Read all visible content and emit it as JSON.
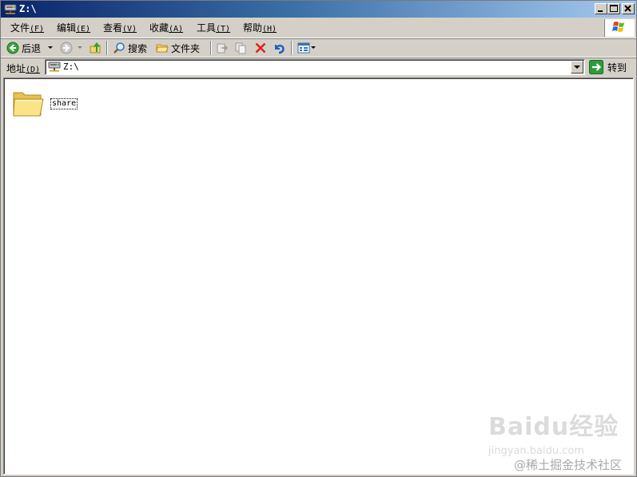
{
  "window": {
    "title": "Z:\\"
  },
  "caption_buttons": {
    "minimize": "_",
    "maximize": "□",
    "close": "×"
  },
  "menu": [
    {
      "label": "文件",
      "accel": "(F)"
    },
    {
      "label": "编辑",
      "accel": "(E)"
    },
    {
      "label": "查看",
      "accel": "(V)"
    },
    {
      "label": "收藏",
      "accel": "(A)"
    },
    {
      "label": "工具",
      "accel": "(T)"
    },
    {
      "label": "帮助",
      "accel": "(H)"
    }
  ],
  "toolbar": {
    "back_label": "后退",
    "search_label": "搜索",
    "folders_label": "文件夹"
  },
  "address": {
    "label": "地址",
    "accel": "(D)",
    "value": "Z:\\",
    "go_label": "转到"
  },
  "files": [
    {
      "name": "share",
      "type": "folder"
    }
  ],
  "watermark": {
    "brand": "Baidu经验",
    "url": "jingyan.baidu.com",
    "credit": "@稀土掘金技术社区"
  },
  "colors": {
    "titlebar_start": "#0a246a",
    "titlebar_end": "#a6caf0",
    "chrome": "#d4d0c8",
    "content_bg": "#ffffff",
    "go_green": "#2e9b3a",
    "delete_red": "#e02020"
  },
  "icons": {
    "title": "network-drive-icon",
    "back": "back-arrow-icon",
    "forward": "forward-arrow-icon",
    "up": "up-folder-icon",
    "search": "magnifier-icon",
    "folders": "folder-tree-icon",
    "move": "move-to-icon",
    "copy": "copy-to-icon",
    "delete": "delete-x-icon",
    "undo": "undo-icon",
    "views": "views-grid-icon",
    "go": "go-arrow-icon",
    "file": "folder-icon"
  }
}
